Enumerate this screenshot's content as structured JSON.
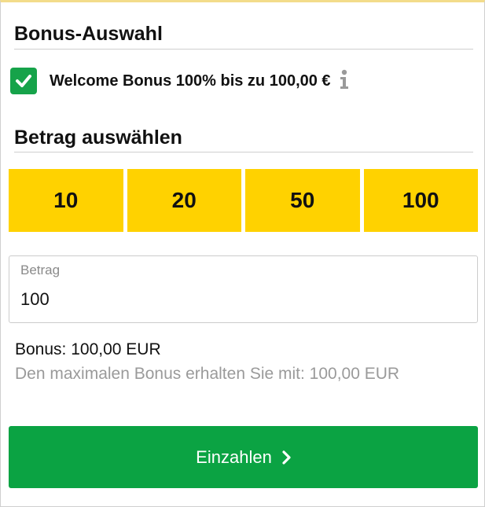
{
  "bonus_section": {
    "title": "Bonus-Auswahl",
    "checkbox_checked": true,
    "offer_label": "Welcome Bonus 100% bis zu 100,00 €",
    "info_icon": "info-icon"
  },
  "amount_section": {
    "title": "Betrag auswählen",
    "quick_amounts": [
      "10",
      "20",
      "50",
      "100"
    ],
    "input": {
      "label": "Betrag",
      "value": "100"
    }
  },
  "summary": {
    "bonus_text": "Bonus: 100,00 EUR",
    "max_bonus_hint": "Den maximalen Bonus erhalten Sie mit: 100,00 EUR"
  },
  "submit": {
    "label": "Einzahlen",
    "icon": "chevron-right-icon"
  },
  "colors": {
    "accent_yellow": "#ffd200",
    "success_green": "#0ba343",
    "checkbox_green": "#16a34a",
    "muted_text": "#9a9a9a"
  }
}
